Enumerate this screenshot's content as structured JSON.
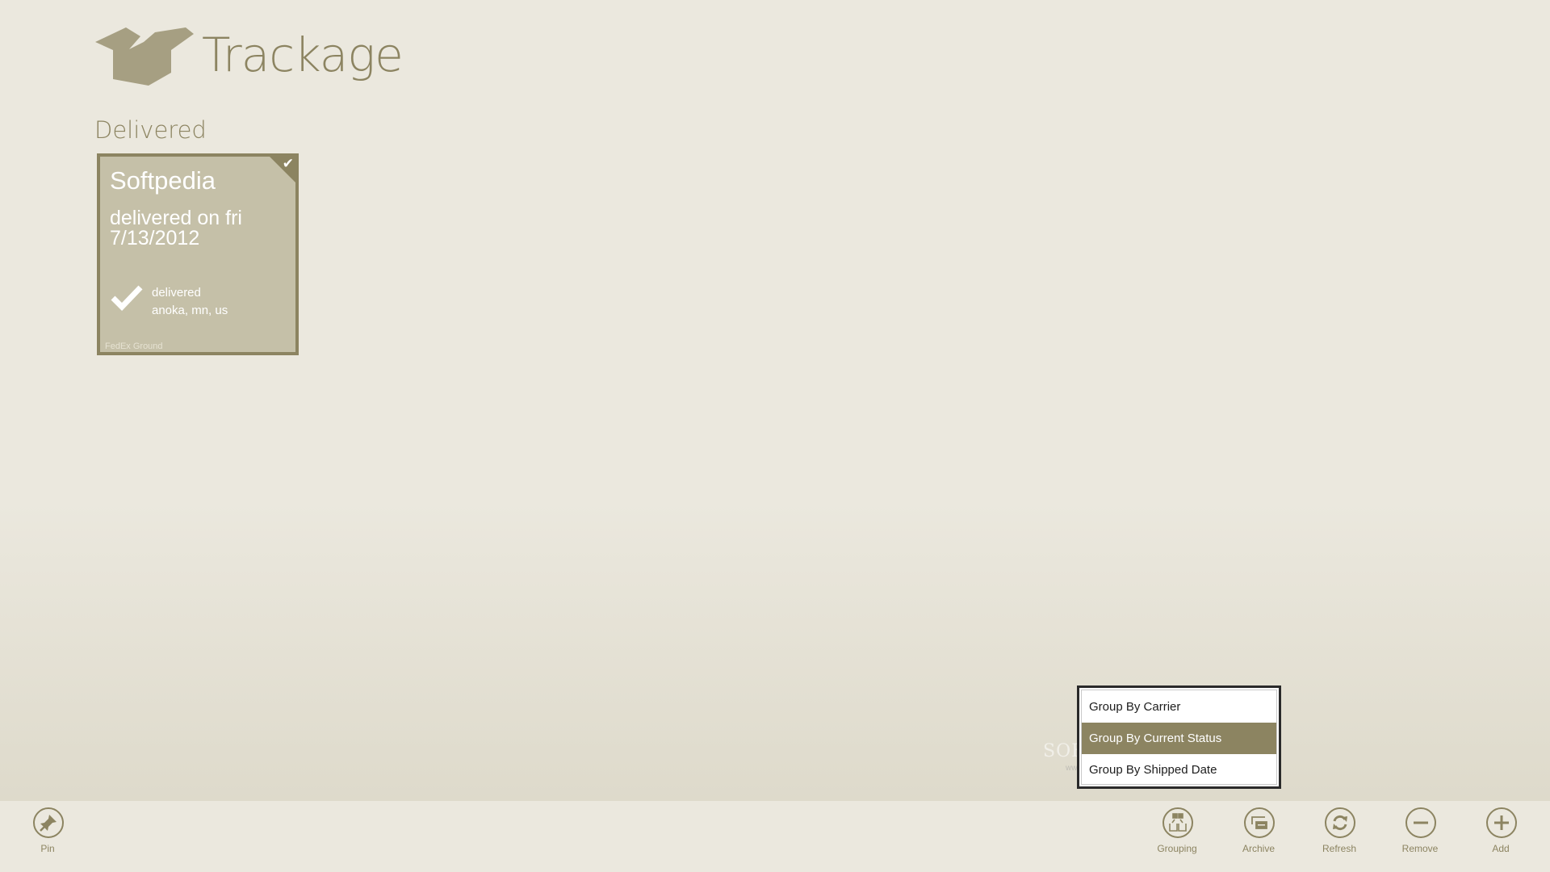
{
  "app": {
    "title": "Trackage",
    "logo_icon": "open-box-icon"
  },
  "colors": {
    "accent": "#8c8461",
    "tile": "#c5c0a8",
    "background": "#ebe8de",
    "logo": "#a69f82"
  },
  "groups": [
    {
      "heading": "Delivered",
      "packages": [
        {
          "name": "Softpedia",
          "eta_text": "delivered on fri 7/13/2012",
          "status_icon": "check-icon",
          "status": "delivered",
          "location": "anoka, mn, us",
          "carrier": "FedEx Ground",
          "selected": true
        }
      ]
    }
  ],
  "grouping_menu": {
    "items": [
      {
        "label": "Group By Carrier",
        "selected": false
      },
      {
        "label": "Group By Current Status",
        "selected": true
      },
      {
        "label": "Group By Shipped Date",
        "selected": false
      }
    ]
  },
  "watermark": {
    "text": "SOFTPEDIA",
    "sub": "www.softpedia.com"
  },
  "appbar": {
    "left": [
      {
        "label": "Pin",
        "icon": "pin-icon"
      }
    ],
    "right": [
      {
        "label": "Grouping",
        "icon": "grouping-icon"
      },
      {
        "label": "Archive",
        "icon": "archive-icon"
      },
      {
        "label": "Refresh",
        "icon": "refresh-icon"
      },
      {
        "label": "Remove",
        "icon": "remove-icon"
      },
      {
        "label": "Add",
        "icon": "add-icon"
      }
    ]
  }
}
